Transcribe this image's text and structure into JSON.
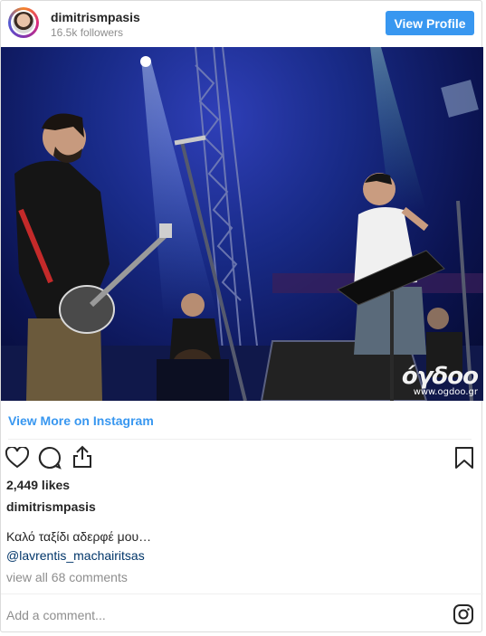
{
  "header": {
    "username": "dimitrismpasis",
    "followers": "16.5k followers",
    "view_profile_label": "View Profile"
  },
  "photo": {
    "watermark_logo": "όγδοο",
    "watermark_url": "www.ogdoo.gr"
  },
  "view_more_label": "View More on Instagram",
  "actions": {
    "icons": [
      "heart-icon",
      "comment-icon",
      "share-icon",
      "bookmark-icon"
    ]
  },
  "likes": "2,449 likes",
  "author": "dimitrismpasis",
  "caption": "Καλό ταξίδι αδερφέ μου…",
  "mention": "@lavrentis_machairitsas",
  "comments_link": "view all 68 comments",
  "comment_input": {
    "placeholder": "Add a comment..."
  },
  "colors": {
    "accent": "#3897f0",
    "muted": "#8e8e8e",
    "text": "#262626",
    "mention": "#003569"
  }
}
